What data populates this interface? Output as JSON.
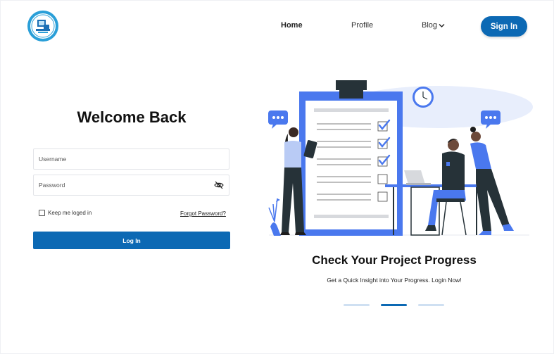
{
  "header": {
    "nav": [
      "Home",
      "Profile",
      "Blog"
    ],
    "signin_label": "Sign In"
  },
  "login": {
    "title": "Welcome Back",
    "username_placeholder": "Username",
    "password_placeholder": "Password",
    "remember_label": "Keep me loged in",
    "forgot_label": "Forgot Password?",
    "submit_label": "Log In"
  },
  "promo": {
    "title": "Check Your Project Progress",
    "subtitle": "Get a Quick Insight into Your Progress. Login Now!",
    "slides": 3,
    "active_slide": 2
  },
  "colors": {
    "accent": "#0c69b4",
    "illustration": "#4a78ee"
  },
  "icons": [
    "logo-icon",
    "chevron-down-icon",
    "eye-off-icon"
  ]
}
